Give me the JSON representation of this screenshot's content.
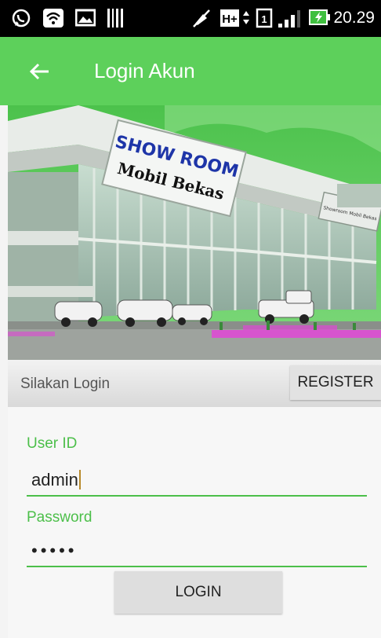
{
  "status_bar": {
    "time": "20.29",
    "icons": [
      "whatsapp-icon",
      "wifi-icon",
      "gallery-icon",
      "barcode-icon",
      "mute-icon",
      "data-hplus-icon",
      "sim-icon",
      "signal-icon",
      "battery-charging-icon"
    ]
  },
  "app_bar": {
    "title": "Login Akun",
    "back_icon": "arrow-left-icon",
    "color": "#5dd05b"
  },
  "hero": {
    "sign_line1": "SHOW ROOM",
    "sign_line2": "Mobil Bekas",
    "side_sign": "Showroom Mobil Bekas"
  },
  "section": {
    "label": "Silakan Login",
    "register_label": "REGISTER"
  },
  "form": {
    "user_id_label": "User ID",
    "user_id_value": "admin",
    "password_label": "Password",
    "password_value": "•••••",
    "login_label": "LOGIN",
    "accent_color": "#4cbf4a"
  }
}
